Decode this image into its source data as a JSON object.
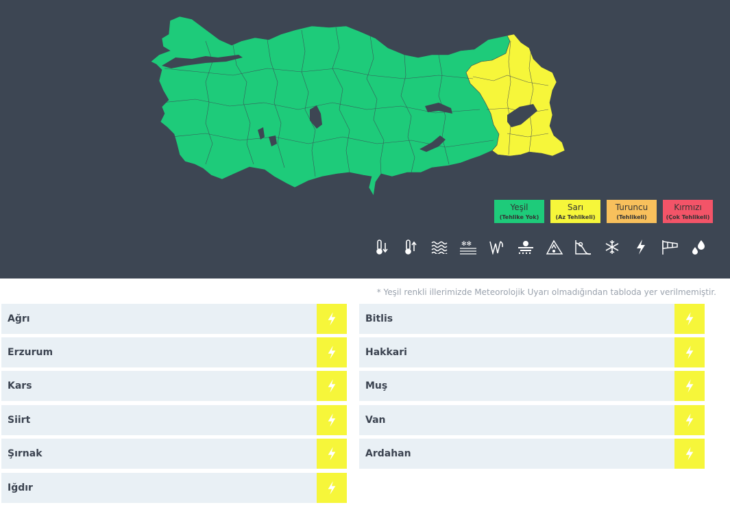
{
  "legend": [
    {
      "label": "Yeşil",
      "sub": "(Tehlike Yok)",
      "color": "#1ecb7a"
    },
    {
      "label": "Sarı",
      "sub": "(Az Tehlikeli)",
      "color": "#f6f63a"
    },
    {
      "label": "Turuncu",
      "sub": "(Tehlikeli)",
      "color": "#f8c05c"
    },
    {
      "label": "Kırmızı",
      "sub": "(Çok Tehlikeli)",
      "color": "#f35468"
    }
  ],
  "hazard_icons": [
    "cold-icon",
    "heat-icon",
    "wave-icon",
    "frost-icon",
    "wind-icon",
    "fog-icon",
    "avalanche-icon",
    "landslide-icon",
    "snow-icon",
    "lightning-icon",
    "windsock-icon",
    "rain-icon"
  ],
  "note": "* Yeşil renkli illerimizde Meteorolojik Uyarı olmadığından tabloda yer verilmemiştir.",
  "warning_color": "#f6f63a",
  "warning_icon": "lightning-icon",
  "provinces_left": [
    "Ağrı",
    "Erzurum",
    "Kars",
    "Siirt",
    "Şırnak",
    "Iğdır"
  ],
  "provinces_right": [
    "Bitlis",
    "Hakkari",
    "Muş",
    "Van",
    "Ardahan"
  ],
  "colors": {
    "panel": "#3d4653",
    "green": "#1ecb7a",
    "yellow": "#f6f63a",
    "row": "#e9f0f5"
  }
}
